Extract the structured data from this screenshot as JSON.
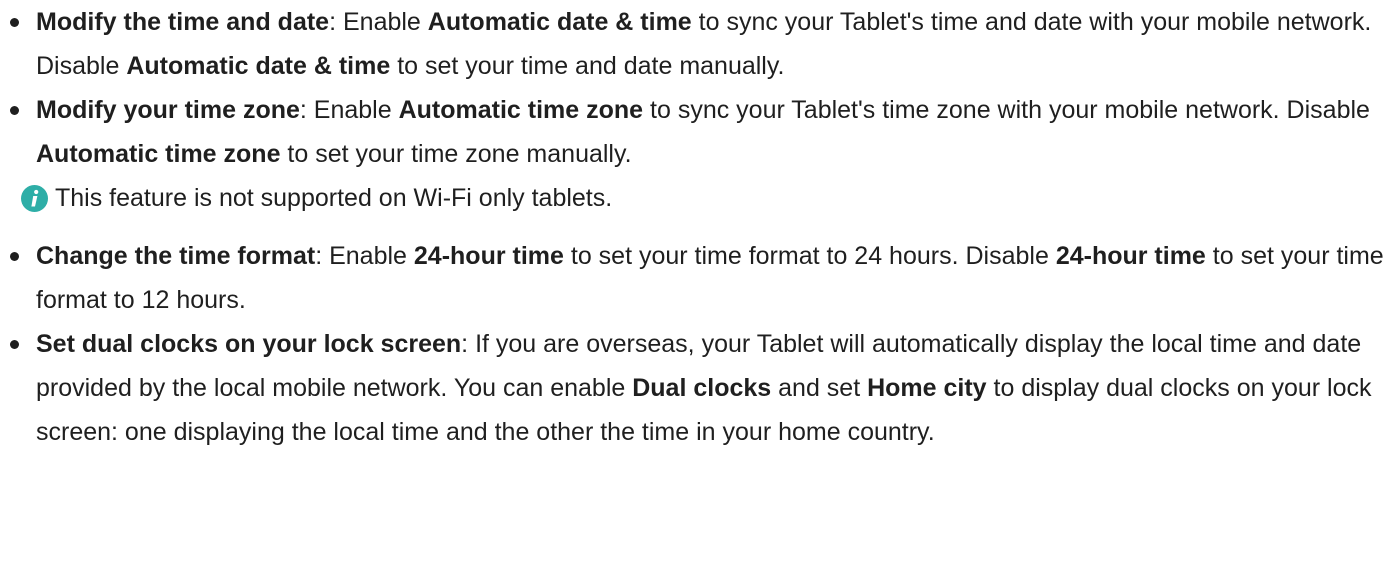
{
  "items": [
    {
      "seg": [
        "Modify the time and date",
        ": Enable ",
        "Automatic date & time",
        " to sync your Tablet's time and date with your mobile network. Disable ",
        "Automatic date & time",
        " to set your time and date manually."
      ]
    },
    {
      "seg": [
        "Modify your time zone",
        ": Enable ",
        "Automatic time zone",
        " to sync your Tablet's time zone with your mobile network. Disable ",
        "Automatic time zone",
        " to set your time zone manually."
      ],
      "note": "This feature is not supported on Wi-Fi only tablets."
    },
    {
      "seg": [
        "Change the time format",
        ": Enable ",
        "24-hour time",
        " to set your time format to 24 hours. Disable ",
        "24-hour time",
        " to set your time format to 12 hours."
      ]
    },
    {
      "seg": [
        "Set dual clocks on your lock screen",
        ": If you are overseas, your Tablet will automatically display the local time and date provided by the local mobile network. You can enable ",
        "Dual clocks",
        " and set ",
        "Home city",
        " to display dual clocks on your lock screen: one displaying the local time and the other the time in your home country."
      ]
    }
  ],
  "colors": {
    "text": "#1f1f1f",
    "info_icon": "#2eaea7"
  },
  "icons": {
    "note": "info-icon"
  }
}
